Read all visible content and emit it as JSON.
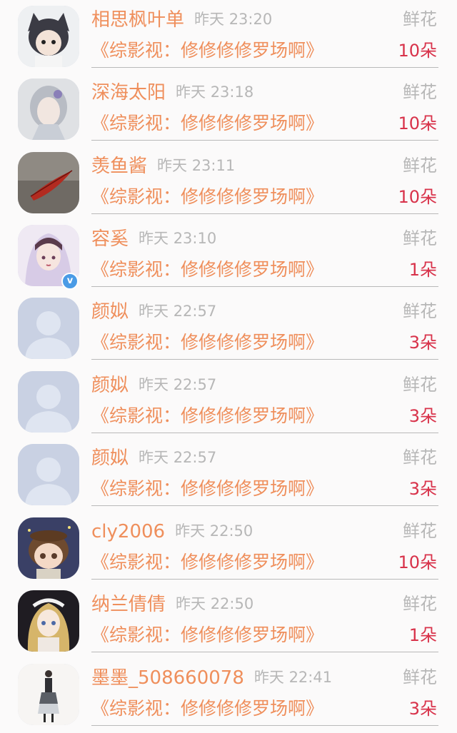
{
  "colors": {
    "name": "#ef8f5c",
    "time": "#b7b7b7",
    "count": "#d8324a",
    "divider": "#b9b9b9"
  },
  "entries": [
    {
      "name": "相思枫叶单",
      "time": "昨天 23:20",
      "gift": "鲜花",
      "book": "《综影视：修修修修罗场啊》",
      "count": "10朵",
      "avatar": "anime-wolf-girl",
      "verified": false
    },
    {
      "name": "深海太阳",
      "time": "昨天 23:18",
      "gift": "鲜花",
      "book": "《综影视：修修修修罗场啊》",
      "count": "10朵",
      "avatar": "anime-silver-hair",
      "verified": false
    },
    {
      "name": "羡鱼酱",
      "time": "昨天 23:11",
      "gift": "鲜花",
      "book": "《综影视：修修修修罗场啊》",
      "count": "10朵",
      "avatar": "red-leaf-photo",
      "verified": false
    },
    {
      "name": "容奚",
      "time": "昨天 23:10",
      "gift": "鲜花",
      "book": "《综影视：修修修修罗场啊》",
      "count": "1朵",
      "avatar": "anime-purple-girl",
      "verified": true
    },
    {
      "name": "颜姒",
      "time": "昨天 22:57",
      "gift": "鲜花",
      "book": "《综影视：修修修修罗场啊》",
      "count": "3朵",
      "avatar": "default-person",
      "verified": false
    },
    {
      "name": "颜姒",
      "time": "昨天 22:57",
      "gift": "鲜花",
      "book": "《综影视：修修修修罗场啊》",
      "count": "3朵",
      "avatar": "default-person",
      "verified": false
    },
    {
      "name": "颜姒",
      "time": "昨天 22:57",
      "gift": "鲜花",
      "book": "《综影视：修修修修罗场啊》",
      "count": "3朵",
      "avatar": "default-person",
      "verified": false
    },
    {
      "name": "cly2006",
      "time": "昨天 22:50",
      "gift": "鲜花",
      "book": "《综影视：修修修修罗场啊》",
      "count": "10朵",
      "avatar": "chibi-boy",
      "verified": false
    },
    {
      "name": "纳兰倩倩",
      "time": "昨天 22:50",
      "gift": "鲜花",
      "book": "《综影视：修修修修罗场啊》",
      "count": "1朵",
      "avatar": "anime-blonde-doll",
      "verified": false
    },
    {
      "name": "墨墨_508660078",
      "time": "昨天 22:41",
      "gift": "鲜花",
      "book": "《综影视：修修修修罗场啊》",
      "count": "3朵",
      "avatar": "fashion-illustration",
      "verified": false
    }
  ]
}
